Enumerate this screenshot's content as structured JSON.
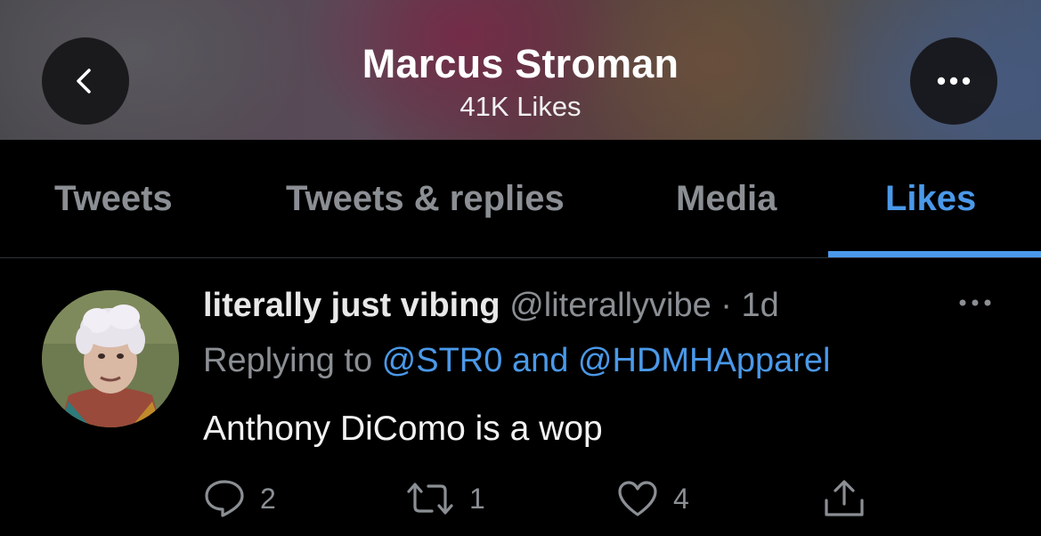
{
  "profile": {
    "name": "Marcus Stroman",
    "subtitle": "41K Likes"
  },
  "tabs": [
    {
      "label": "Tweets",
      "active": false
    },
    {
      "label": "Tweets & replies",
      "active": false
    },
    {
      "label": "Media",
      "active": false
    },
    {
      "label": "Likes",
      "active": true
    }
  ],
  "tweet": {
    "display_name": "literally just vibing",
    "handle": "@literallyvibe",
    "separator": " · ",
    "time": "1d",
    "reply_prefix": "Replying to ",
    "reply_user1": "@STR0",
    "reply_join": " and ",
    "reply_user2": "@HDMHApparel",
    "text": "Anthony DiComo is a wop",
    "actions": {
      "reply_count": "2",
      "retweet_count": "1",
      "like_count": "4"
    }
  },
  "icons": {
    "back": "chevron-left-icon",
    "more": "more-horizontal-icon",
    "reply": "speech-bubble-icon",
    "retweet": "retweet-icon",
    "like": "heart-icon",
    "share": "share-icon"
  },
  "colors": {
    "accent": "#4a99e9",
    "muted": "#8b8f94",
    "background": "#000000"
  }
}
